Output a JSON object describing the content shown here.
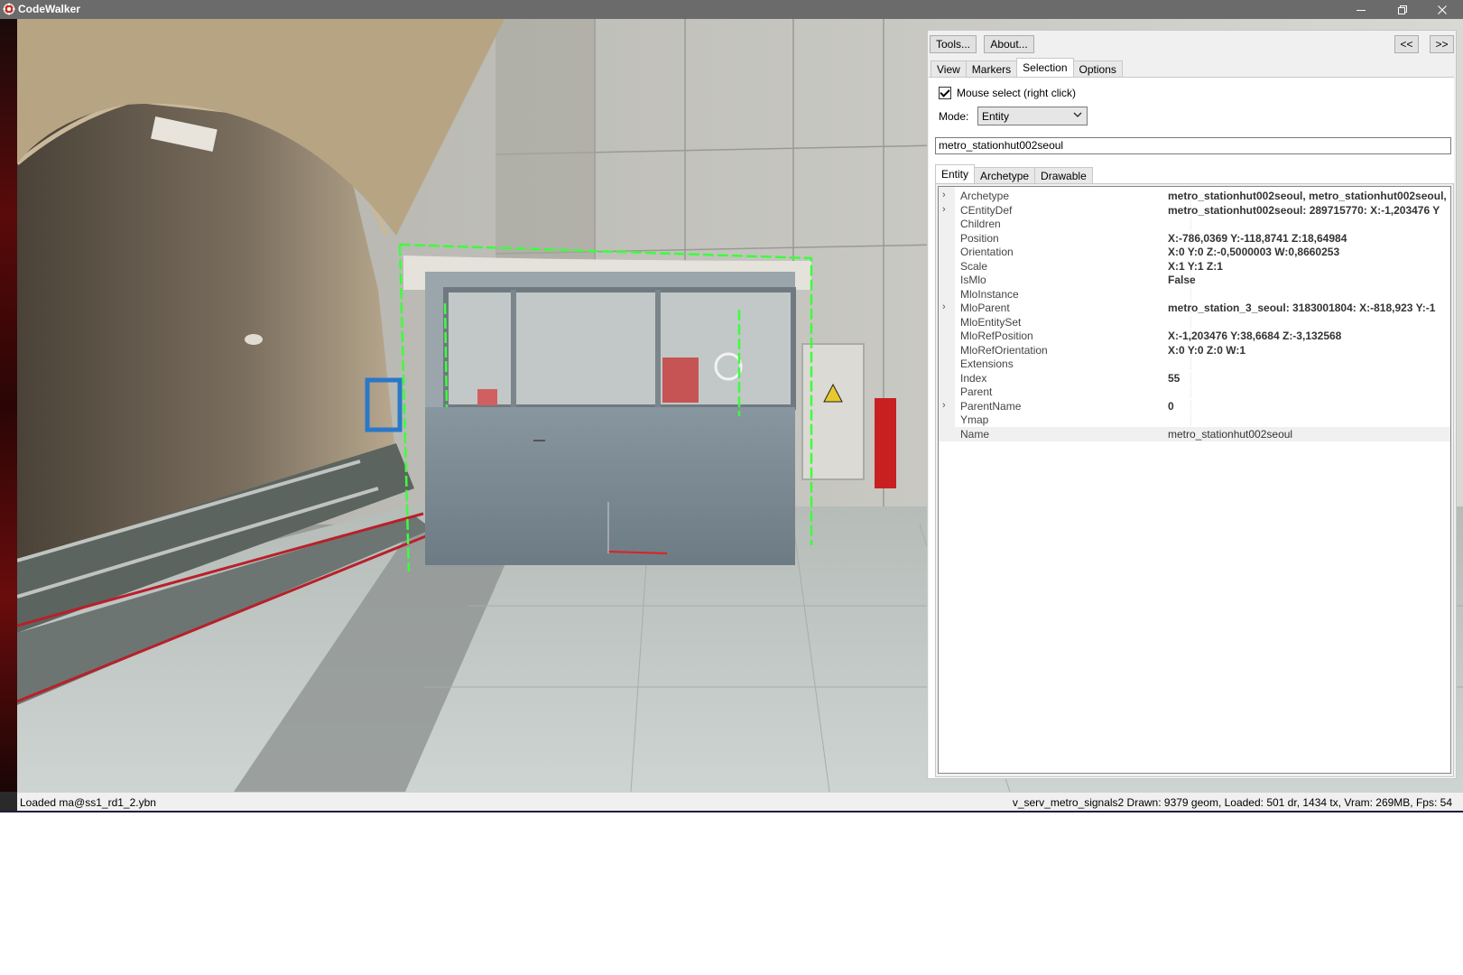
{
  "window": {
    "title": "CodeWalker",
    "icon": "codewalker-gear-icon",
    "controls": [
      "minimize-icon",
      "restore-icon",
      "close-icon"
    ]
  },
  "toolbar": {
    "tools_label": "Tools...",
    "about_label": "About...",
    "prev_label": "<<",
    "next_label": ">>"
  },
  "main_tabs": [
    {
      "label": "View",
      "active": false
    },
    {
      "label": "Markers",
      "active": false
    },
    {
      "label": "Selection",
      "active": true
    },
    {
      "label": "Options",
      "active": false
    }
  ],
  "selection": {
    "mouse_select_label": "Mouse select (right click)",
    "mouse_select_checked": true,
    "mode_label": "Mode:",
    "mode_value": "Entity",
    "name_field_value": "metro_stationhut002seoul"
  },
  "sub_tabs": [
    {
      "label": "Entity",
      "active": true
    },
    {
      "label": "Archetype",
      "active": false
    },
    {
      "label": "Drawable",
      "active": false
    }
  ],
  "properties": [
    {
      "name": "Archetype",
      "value": "metro_stationhut002seoul, metro_stationhut002seoul, ",
      "expandable": true,
      "bold": true
    },
    {
      "name": "CEntityDef",
      "value": "metro_stationhut002seoul: 289715770: X:-1,203476 Y",
      "expandable": true,
      "bold": true
    },
    {
      "name": "Children",
      "value": "",
      "expandable": false,
      "bold": true
    },
    {
      "name": "Position",
      "value": "X:-786,0369 Y:-118,8741 Z:18,64984",
      "expandable": false,
      "bold": true
    },
    {
      "name": "Orientation",
      "value": "X:0 Y:0 Z:-0,5000003 W:0,8660253",
      "expandable": false,
      "bold": true
    },
    {
      "name": "Scale",
      "value": "X:1 Y:1 Z:1",
      "expandable": false,
      "bold": true
    },
    {
      "name": "IsMlo",
      "value": "False",
      "expandable": false,
      "bold": true
    },
    {
      "name": "MloInstance",
      "value": "",
      "expandable": false,
      "bold": true
    },
    {
      "name": "MloParent",
      "value": "metro_station_3_seoul: 3183001804: X:-818,923 Y:-1",
      "expandable": true,
      "bold": true
    },
    {
      "name": "MloEntitySet",
      "value": "",
      "expandable": false,
      "bold": true
    },
    {
      "name": "MloRefPosition",
      "value": "X:-1,203476 Y:38,6684 Z:-3,132568",
      "expandable": false,
      "bold": true
    },
    {
      "name": "MloRefOrientation",
      "value": "X:0 Y:0 Z:0 W:1",
      "expandable": false,
      "bold": true
    },
    {
      "name": "Extensions",
      "value": "",
      "expandable": false,
      "bold": true
    },
    {
      "name": "Index",
      "value": "55",
      "expandable": false,
      "bold": true
    },
    {
      "name": "Parent",
      "value": "",
      "expandable": false,
      "bold": true
    },
    {
      "name": "ParentName",
      "value": "0",
      "expandable": true,
      "bold": true
    },
    {
      "name": "Ymap",
      "value": "",
      "expandable": false,
      "bold": true
    },
    {
      "name": "Name",
      "value": "metro_stationhut002seoul",
      "expandable": false,
      "bold": false,
      "selected": true
    }
  ],
  "status": {
    "left": "Loaded ma@ss1_rd1_2.ybn",
    "right": "v_serv_metro_signals2  Drawn: 9379 geom, Loaded: 501 dr, 1434 tx, Vram: 269MB, Fps: 54"
  },
  "colors": {
    "selection_box": "#3cff3c",
    "titlebar": "#6b6b6b",
    "panel_bg": "#f0f0f0",
    "rail_stripe": "#b8202a"
  }
}
